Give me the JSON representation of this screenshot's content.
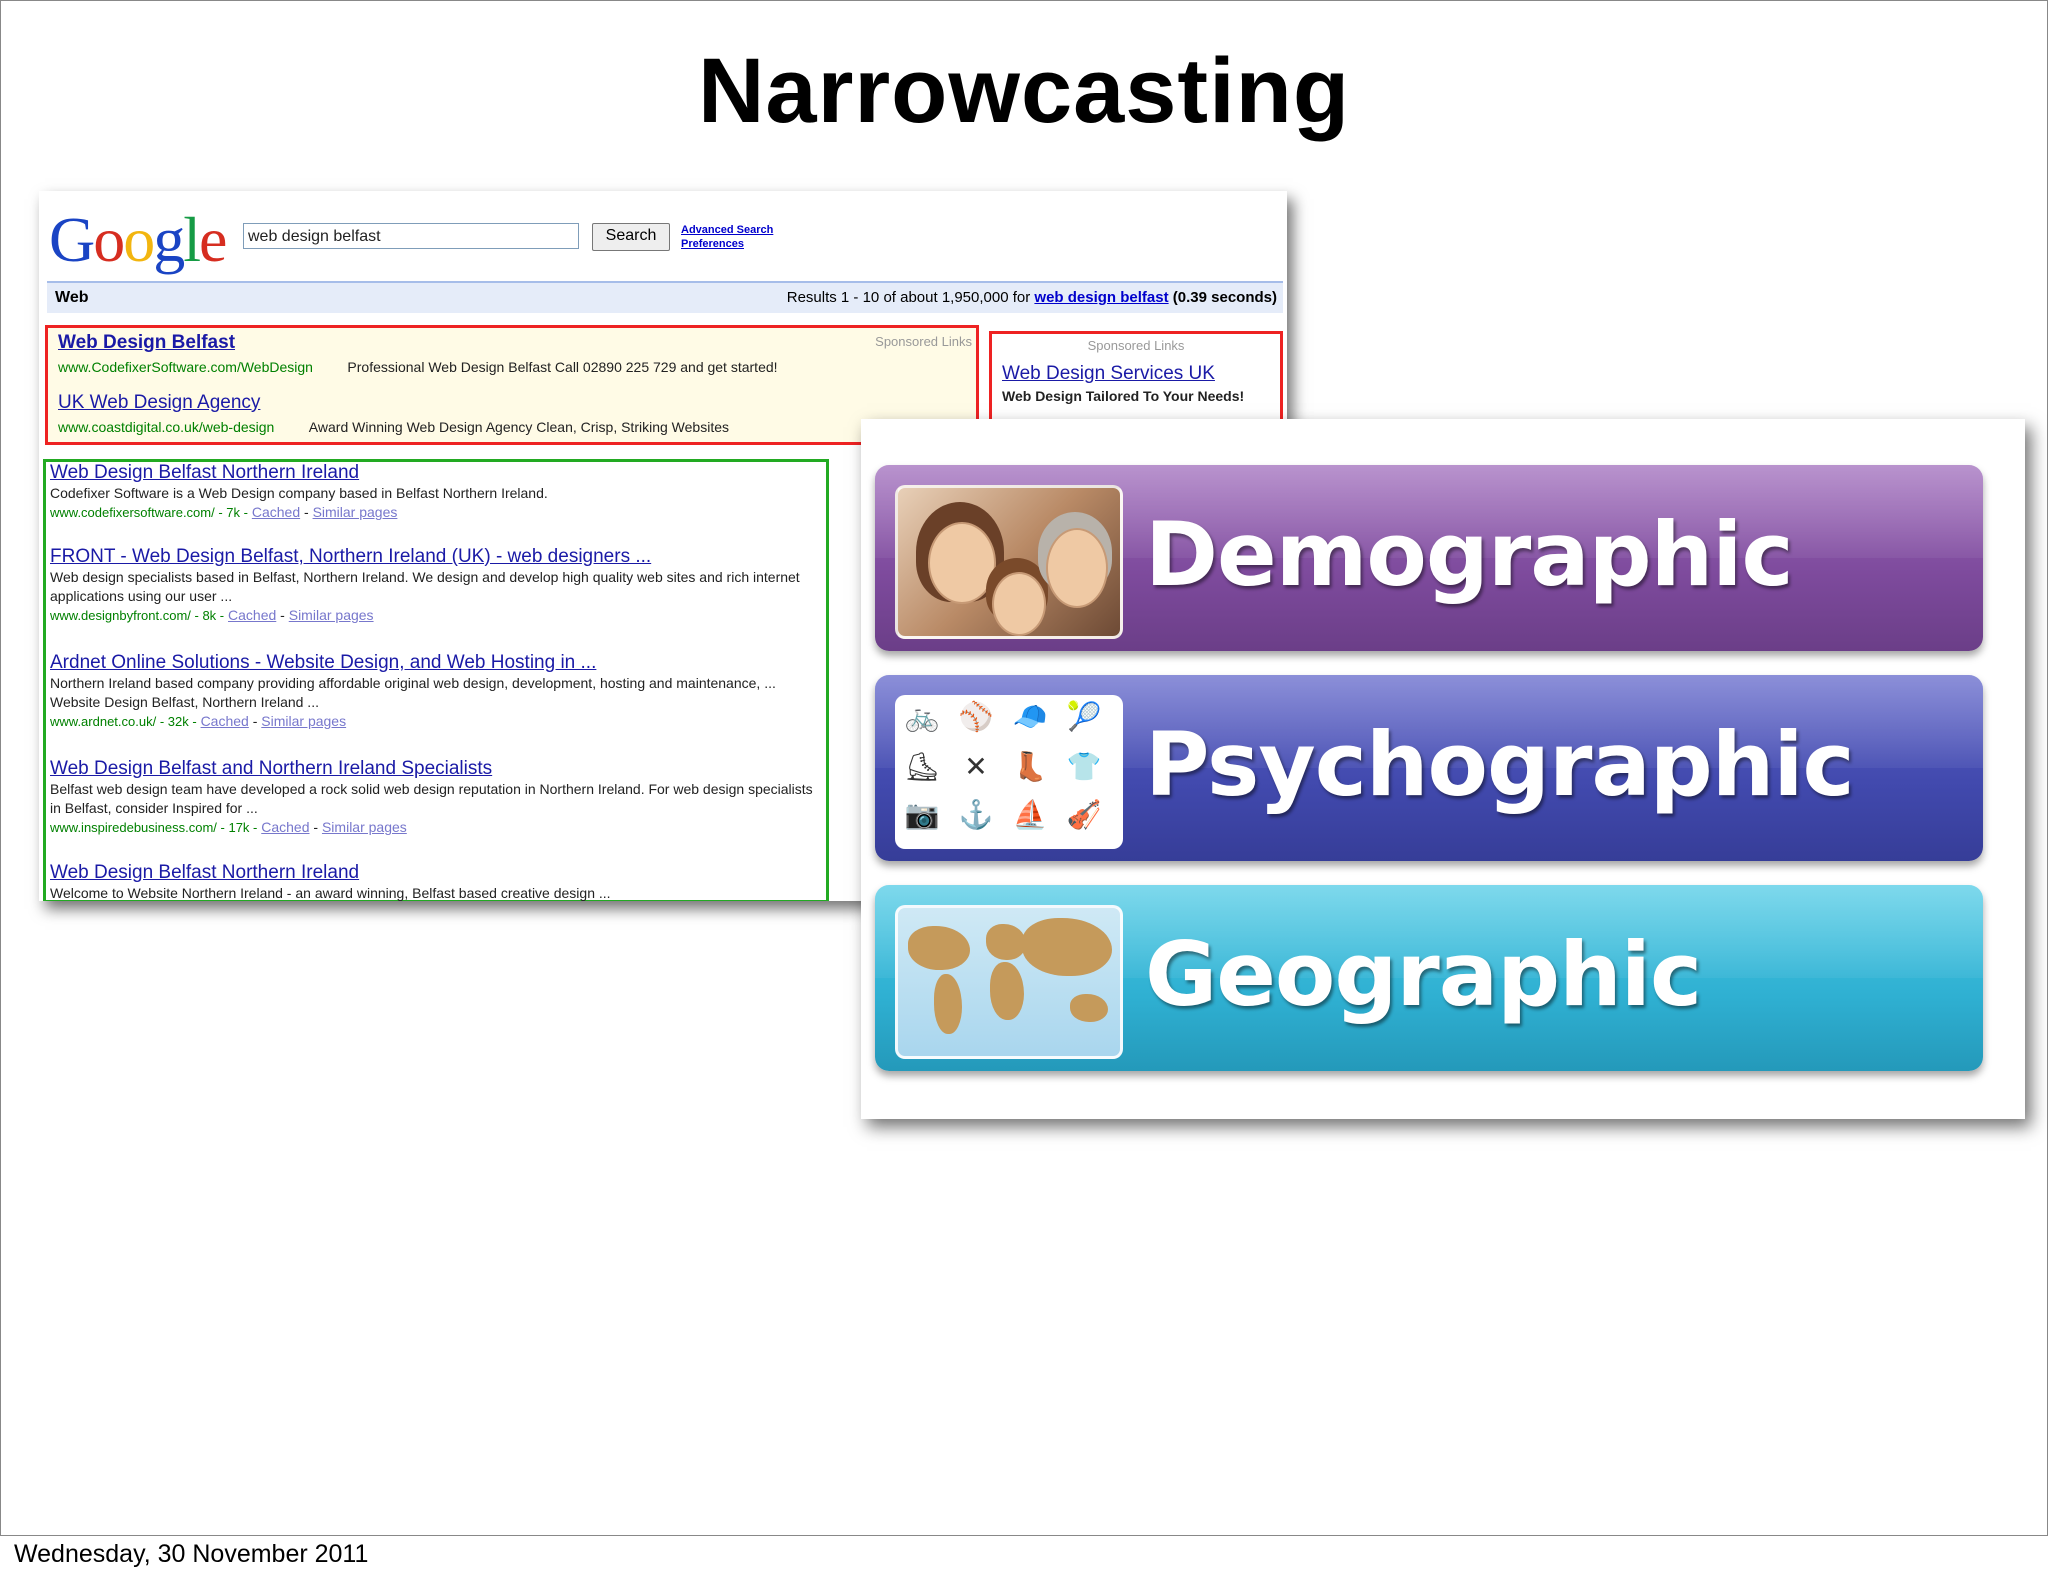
{
  "slide": {
    "title": "Narrowcasting",
    "footer_date": "Wednesday, 30 November 2011"
  },
  "google": {
    "logo": [
      "G",
      "o",
      "o",
      "g",
      "l",
      "e"
    ],
    "logo_colors": [
      "#1a44c4",
      "#d62d20",
      "#f2b50f",
      "#1a44c4",
      "#169b45",
      "#d62d20"
    ],
    "search_value": "web design belfast",
    "search_button": "Search",
    "advanced_search": "Advanced Search",
    "preferences": "Preferences",
    "tab_web": "Web",
    "stats_prefix": "Results 1 - 10 of about 1,950,000 for",
    "stats_query": "web design belfast",
    "stats_time": "(0.39 seconds)",
    "sponsored_links": "Sponsored Links",
    "ads": [
      {
        "title": "Web Design Belfast",
        "url": "www.CodefixerSoftware.com/WebDesign",
        "desc": "Professional Web Design Belfast Call 02890 225 729 and get started!"
      },
      {
        "title": "UK Web Design Agency",
        "url": "www.coastdigital.co.uk/web-design",
        "desc": "Award Winning Web Design Agency Clean, Crisp, Striking Websites"
      }
    ],
    "side_ad": {
      "title": "Web Design Services UK",
      "desc": "Web Design Tailored To Your Needs!"
    },
    "results": [
      {
        "title": "Web Design Belfast Northern Ireland",
        "desc": "Codefixer Software is a Web Design company based in Belfast Northern Ireland.",
        "url": "www.codefixersoftware.com/ - 7k -",
        "cached": "Cached",
        "similar": "Similar pages"
      },
      {
        "title": "FRONT - Web Design Belfast, Northern Ireland (UK) - web designers ...",
        "desc": "Web design specialists based in Belfast, Northern Ireland. We design and develop high quality web sites and rich internet applications using our user ...",
        "url": "www.designbyfront.com/ - 8k -",
        "cached": "Cached",
        "similar": "Similar pages"
      },
      {
        "title": "Ardnet Online Solutions - Website Design, and Web Hosting in ...",
        "desc": "Northern Ireland based company providing affordable original web design, development, hosting and maintenance, ... Website Design Belfast, Northern Ireland ...",
        "url": "www.ardnet.co.uk/ - 32k -",
        "cached": "Cached",
        "similar": "Similar pages"
      },
      {
        "title": "Web Design Belfast and Northern Ireland Specialists",
        "desc": "Belfast web design team have developed a rock solid web design reputation in Northern Ireland. For web design specialists in Belfast, consider Inspired for ...",
        "url": "www.inspiredebusiness.com/ - 17k -",
        "cached": "Cached",
        "similar": "Similar pages"
      },
      {
        "title": "Web Design Belfast Northern Ireland",
        "desc": "Welcome to Website Northern Ireland - an award winning, Belfast based creative design ...",
        "url": "",
        "cached": "",
        "similar": ""
      }
    ]
  },
  "segments": [
    {
      "label": "Demographic",
      "thumb": "family-photo",
      "color": "#7d4a9c"
    },
    {
      "label": "Psychographic",
      "thumb": "hobby-icons",
      "color": "#4149ad"
    },
    {
      "label": "Geographic",
      "thumb": "world-map",
      "color": "#2fb0d2"
    }
  ]
}
